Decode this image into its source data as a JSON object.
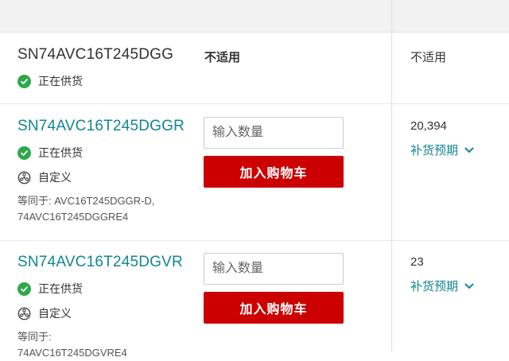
{
  "colors": {
    "link": "#12868f",
    "cart_button": "#cc0000",
    "in_stock": "#2ea84a"
  },
  "rows": [
    {
      "part_number": "SN74AVC16T245DGG",
      "status": "正在供货",
      "buy_column": "不适用",
      "stock_column": "不适用"
    },
    {
      "part_number": "SN74AVC16T245DGGR",
      "status": "正在供货",
      "custom": "自定义",
      "equivalent_line1": "等同于: AVC16T245DGGR-D,",
      "equivalent_line2": "74AVC16T245DGGRE4",
      "qty_placeholder": "输入数量",
      "cart_label": "加入购物车",
      "stock": "20,394",
      "restock_label": "补货预期"
    },
    {
      "part_number": "SN74AVC16T245DGVR",
      "status": "正在供货",
      "custom": "自定义",
      "equivalent_line1": "等同于:",
      "equivalent_line2": "74AVC16T245DGVRE4",
      "qty_placeholder": "输入数量",
      "cart_label": "加入购物车",
      "stock": "23",
      "restock_label": "补货预期"
    }
  ]
}
